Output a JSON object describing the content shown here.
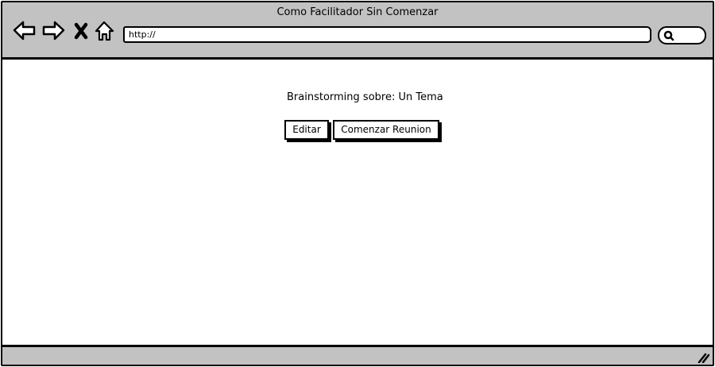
{
  "window": {
    "title": "Como Facilitador Sin Comenzar"
  },
  "toolbar": {
    "back_icon": "back-arrow-icon",
    "forward_icon": "forward-arrow-icon",
    "stop_icon": "stop-x-icon",
    "home_icon": "home-icon",
    "url_value": "http://",
    "search_icon": "magnifier-icon"
  },
  "main": {
    "heading": "Brainstorming sobre: Un Tema",
    "edit_label": "Editar",
    "start_label": "Comenzar Reunion"
  },
  "statusbar": {
    "resize_icon": "resize-grip-icon"
  },
  "colors": {
    "chrome": "#c2c2c2",
    "border": "#000000",
    "background": "#ffffff"
  }
}
